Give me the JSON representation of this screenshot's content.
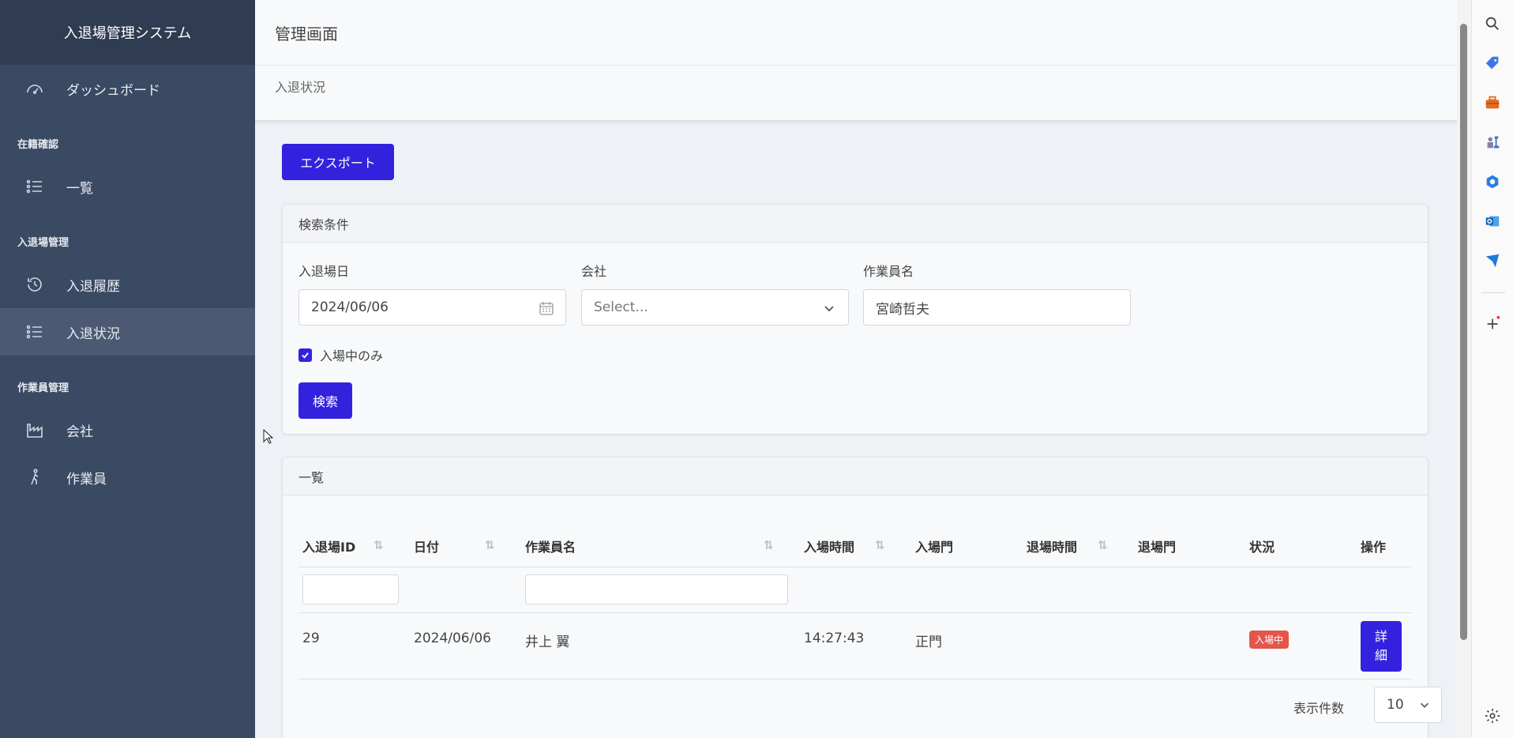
{
  "app": {
    "title": "入退場管理システム"
  },
  "sidebar": {
    "dashboard": "ダッシュボード",
    "sections": [
      {
        "label": "在籍確認",
        "items": [
          {
            "label": "一覧",
            "icon": "list-icon"
          }
        ]
      },
      {
        "label": "入退場管理",
        "items": [
          {
            "label": "入退履歴",
            "icon": "history-icon"
          },
          {
            "label": "入退状況",
            "icon": "list-icon",
            "active": true
          }
        ]
      },
      {
        "label": "作業員管理",
        "items": [
          {
            "label": "会社",
            "icon": "factory-icon"
          },
          {
            "label": "作業員",
            "icon": "walking-person-icon"
          }
        ]
      }
    ]
  },
  "header": {
    "title": "管理画面",
    "breadcrumb": "入退状況"
  },
  "export_button": "エクスポート",
  "search": {
    "heading": "検索条件",
    "date_label": "入退場日",
    "date_value": "2024/06/06",
    "company_label": "会社",
    "company_placeholder": "Select...",
    "worker_label": "作業員名",
    "worker_value": "宮崎哲夫",
    "checkbox_label": "入場中のみ",
    "checkbox_checked": true,
    "search_button": "検索"
  },
  "list": {
    "heading": "一覧",
    "columns": [
      "入退場ID",
      "日付",
      "作業員名",
      "入場時間",
      "入場門",
      "退場時間",
      "退場門",
      "状況",
      "操作"
    ],
    "rows": [
      {
        "id": "29",
        "date": "2024/06/06",
        "worker": "井上 翼",
        "entry_time": "14:27:43",
        "entry_gate": "正門",
        "exit_time": "",
        "exit_gate": "",
        "status": "入場中",
        "action": "詳細"
      }
    ],
    "per_page_label": "表示件数",
    "per_page_value": "10"
  },
  "colors": {
    "sidebar": "#3b4a63",
    "primary": "#3322dd",
    "status_in": "#e3564a"
  }
}
